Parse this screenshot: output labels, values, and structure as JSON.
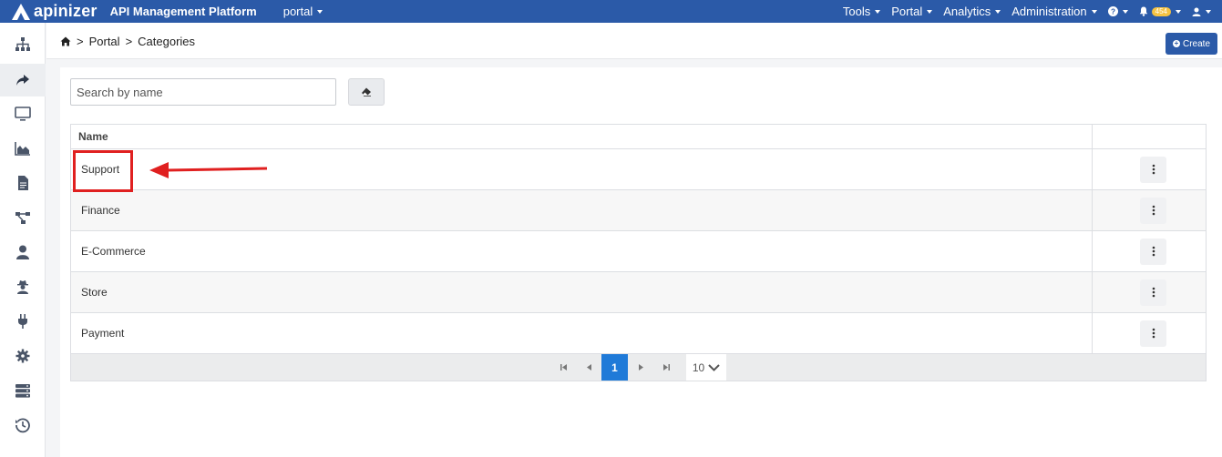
{
  "navbar": {
    "brand": "apinizer",
    "platform": "API Management Platform",
    "context": "portal",
    "menus": [
      {
        "label": "Tools"
      },
      {
        "label": "Portal"
      },
      {
        "label": "Analytics"
      },
      {
        "label": "Administration"
      }
    ],
    "notification_count": "454",
    "colors": {
      "bar": "#2b5aa8",
      "badge": "#f6c343"
    }
  },
  "sidebar": {
    "items": [
      {
        "icon": "sitemap-icon"
      },
      {
        "icon": "share-arrow-icon",
        "active": true
      },
      {
        "icon": "monitor-icon"
      },
      {
        "icon": "area-chart-icon"
      },
      {
        "icon": "document-icon"
      },
      {
        "icon": "topology-icon"
      },
      {
        "icon": "user-icon"
      },
      {
        "icon": "user-secret-icon"
      },
      {
        "icon": "plug-icon"
      },
      {
        "icon": "cog-icon"
      },
      {
        "icon": "server-icon"
      },
      {
        "icon": "history-icon"
      }
    ]
  },
  "breadcrumb": {
    "home_icon": "home-icon",
    "items": [
      "Portal",
      "Categories"
    ],
    "separator": ">"
  },
  "actions": {
    "create_label": "Create"
  },
  "search": {
    "placeholder": "Search by name",
    "value": ""
  },
  "table": {
    "columns": [
      "Name",
      ""
    ],
    "rows": [
      {
        "name": "Support"
      },
      {
        "name": "Finance"
      },
      {
        "name": "E-Commerce"
      },
      {
        "name": "Store"
      },
      {
        "name": "Payment"
      }
    ]
  },
  "pagination": {
    "current_page": "1",
    "page_size": "10"
  },
  "annotation": {
    "highlight_color": "#e02020",
    "highlighted_row": "Support"
  }
}
